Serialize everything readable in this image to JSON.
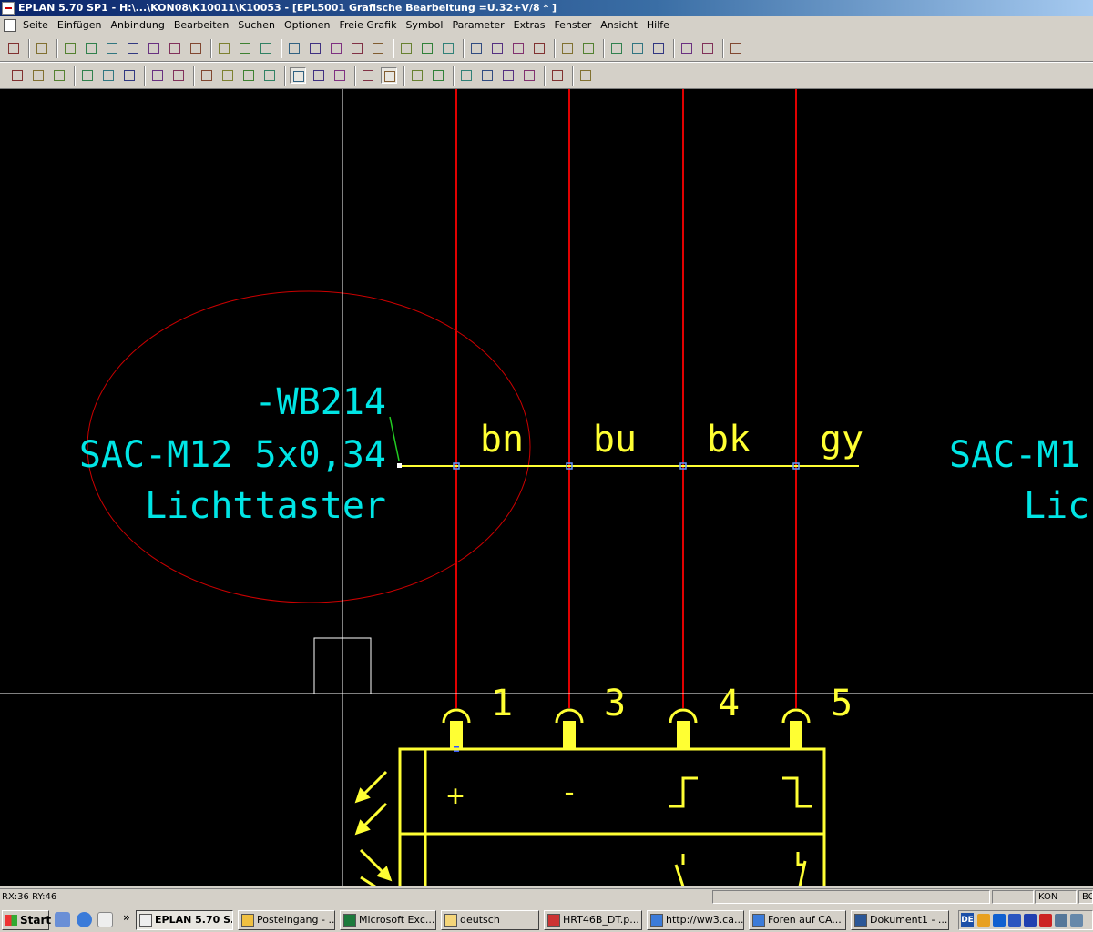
{
  "window": {
    "title": "EPLAN 5.70 SP1 - H:\\...\\KON08\\K10011\\K10053 - [EPL5001 Grafische Bearbeitung =U.32+V/8  * ]"
  },
  "menu": [
    "Seite",
    "Einfügen",
    "Anbindung",
    "Bearbeiten",
    "Suchen",
    "Optionen",
    "Freie Grafik",
    "Symbol",
    "Parameter",
    "Extras",
    "Fenster",
    "Ansicht",
    "Hilfe"
  ],
  "colors": {
    "canvas": "#000000",
    "cable_text": "#00e5e5",
    "wire_labels": "#ffff33",
    "connection_lines": "#e00000",
    "selection_ellipse": "#cc0000",
    "crosshair": "#ffffff"
  },
  "drawing": {
    "cable": {
      "name": "-WB214",
      "type": "SAC-M12 5x0,34",
      "function": "Lichttaster"
    },
    "cable_right_partial": {
      "type": "SAC-M1",
      "function": "Lic"
    },
    "cores": [
      "bn",
      "bu",
      "bk",
      "gy"
    ],
    "terminals": [
      "1",
      "3",
      "4",
      "5"
    ],
    "device_symbols": [
      "+",
      "-"
    ]
  },
  "toolbars": {
    "row1_icons": [
      "eplan-icon",
      "page-tree-icon",
      "new-page-icon",
      "open-icon",
      "open-folder-icon",
      "save-icon",
      "copy-icon",
      "delete-icon",
      "page-props-icon",
      "page-up-icon",
      "page-down-icon",
      "copy-page-icon",
      "print-icon",
      "edit-icon",
      "filter-icon",
      "macro-icon",
      "list-icon",
      "pointer-icon",
      "undo-icon",
      "redo-icon",
      "cut-icon",
      "copy-symbol-icon",
      "insert-icon",
      "remove-icon",
      "connect-icon",
      "disconnect-icon",
      "window-1-icon",
      "window-2-icon",
      "window-3-icon",
      "help-icon",
      "context-help-icon",
      "binoculars-icon"
    ],
    "row2_icons": [
      "device-1-icon",
      "device-2-icon",
      "device-3-icon",
      "tree-1-icon",
      "tree-2-icon",
      "tree-3-icon",
      "props-1-icon",
      "props-2-icon",
      "wire-1-icon",
      "wire-2-icon",
      "wire-3-icon",
      "wire-4-icon",
      "crosshair-snap-icon",
      "grid-icon",
      "connection-icon",
      "hand-icon",
      "pencil-icon",
      "symbol-ref-icon",
      "swap-icon",
      "zoom-in-icon",
      "zoom-window-icon",
      "zoom-out-icon",
      "zoom-all-icon",
      "ruler-icon",
      "refresh-icon"
    ]
  },
  "status": {
    "coords": "RX:36 RY:46",
    "mode": "KON",
    "extra": "BC"
  },
  "taskbar": {
    "start": "Start",
    "more": "»",
    "items": [
      {
        "label": "EPLAN 5.70 S...",
        "active": true
      },
      {
        "label": "Posteingang - ...",
        "active": false
      },
      {
        "label": "Microsoft Exc...",
        "active": false
      },
      {
        "label": "deutsch",
        "active": false
      },
      {
        "label": "HRT46B_DT.p...",
        "active": false
      },
      {
        "label": "http://ww3.ca...",
        "active": false
      },
      {
        "label": "Foren auf CA...",
        "active": false
      },
      {
        "label": "Dokument1 - ...",
        "active": false
      }
    ],
    "tray_lang": "DE"
  }
}
